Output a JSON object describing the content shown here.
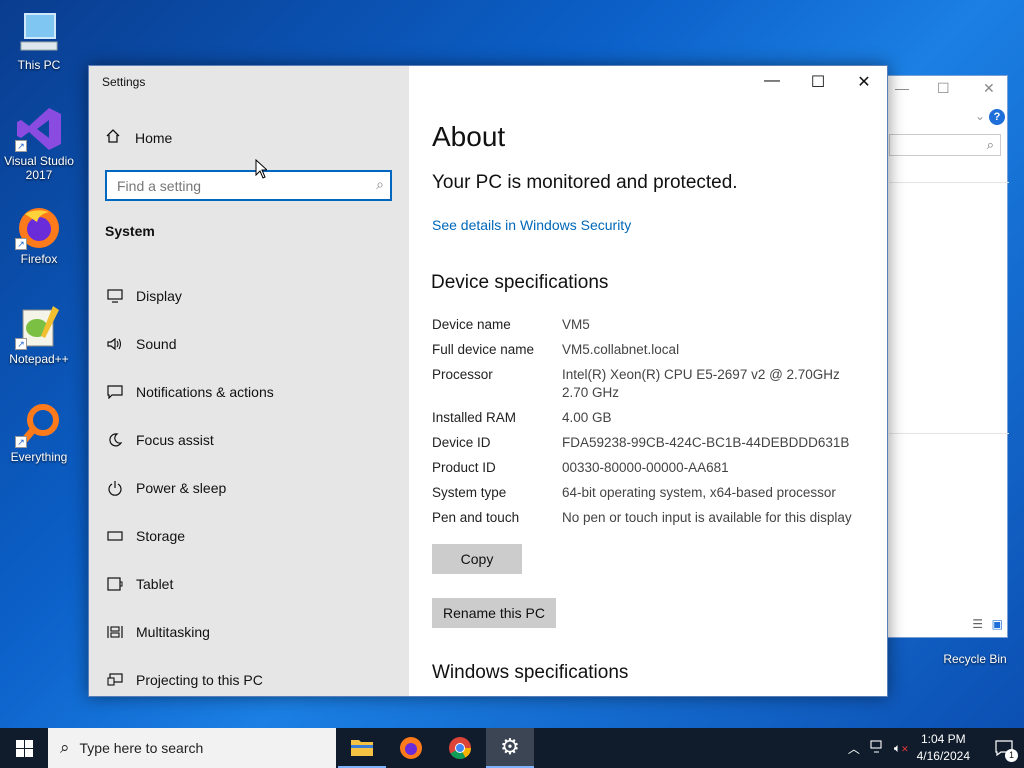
{
  "desktop": {
    "icons": [
      {
        "label": "This PC"
      },
      {
        "label": "Visual Studio 2017"
      },
      {
        "label": "Firefox"
      },
      {
        "label": "Notepad++"
      },
      {
        "label": "Everything"
      },
      {
        "label": "Recycle Bin"
      }
    ]
  },
  "settings": {
    "window_title": "Settings",
    "home_label": "Home",
    "search_placeholder": "Find a setting",
    "section_title": "System",
    "nav_items": [
      {
        "label": "Display",
        "icon": "display-icon"
      },
      {
        "label": "Sound",
        "icon": "sound-icon"
      },
      {
        "label": "Notifications & actions",
        "icon": "notifications-icon"
      },
      {
        "label": "Focus assist",
        "icon": "moon-icon"
      },
      {
        "label": "Power & sleep",
        "icon": "power-icon"
      },
      {
        "label": "Storage",
        "icon": "storage-icon"
      },
      {
        "label": "Tablet",
        "icon": "tablet-icon"
      },
      {
        "label": "Multitasking",
        "icon": "multitasking-icon"
      },
      {
        "label": "Projecting to this PC",
        "icon": "projecting-icon"
      }
    ],
    "content": {
      "title": "About",
      "protection_status": "Your PC is monitored and protected.",
      "security_link": "See details in Windows Security",
      "device_specs_heading": "Device specifications",
      "specs": [
        {
          "key": "Device name",
          "value": "VM5"
        },
        {
          "key": "Full device name",
          "value": "VM5.collabnet.local"
        },
        {
          "key": "Processor",
          "value": "Intel(R) Xeon(R) CPU E5-2697 v2 @ 2.70GHz",
          "value2": "2.70 GHz"
        },
        {
          "key": "Installed RAM",
          "value": "4.00 GB"
        },
        {
          "key": "Device ID",
          "value": "FDA59238-99CB-424C-BC1B-44DEBDDD631B"
        },
        {
          "key": "Product ID",
          "value": "00330-80000-00000-AA681"
        },
        {
          "key": "System type",
          "value": "64-bit operating system, x64-based processor"
        },
        {
          "key": "Pen and touch",
          "value": "No pen or touch input is available for this display"
        }
      ],
      "copy_button": "Copy",
      "rename_button": "Rename this PC",
      "windows_specs_heading": "Windows specifications"
    }
  },
  "taskbar": {
    "search_placeholder": "Type here to search",
    "time": "1:04 PM",
    "date": "4/16/2024",
    "notification_count": "1"
  },
  "colors": {
    "accent": "#0067c0",
    "link": "#0067b8",
    "sidebar_bg": "#e6e6e6",
    "taskbar_bg": "#101c2c"
  }
}
